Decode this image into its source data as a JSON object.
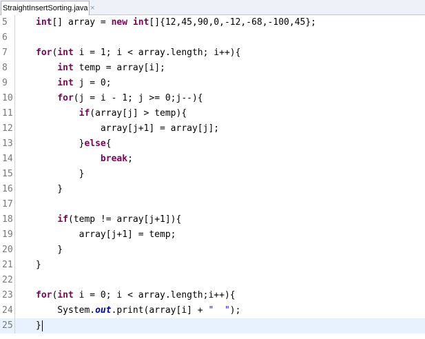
{
  "tab": {
    "title": "StraightInsertSorting.java",
    "close_glyph": "×"
  },
  "editor": {
    "lines": [
      {
        "num": "5",
        "code": "        int[] array = new int[]{12,45,90,0,-12,-68,-100,45};"
      },
      {
        "num": "6",
        "code": ""
      },
      {
        "num": "7",
        "code": "        for(int i = 1; i < array.length; i++){"
      },
      {
        "num": "8",
        "code": "            int temp = array[i];"
      },
      {
        "num": "9",
        "code": "            int j = 0;"
      },
      {
        "num": "10",
        "code": "            for(j = i - 1; j >= 0;j--){"
      },
      {
        "num": "11",
        "code": "                if(array[j] > temp){"
      },
      {
        "num": "12",
        "code": "                    array[j+1] = array[j];"
      },
      {
        "num": "13",
        "code": "                }else{"
      },
      {
        "num": "14",
        "code": "                    break;"
      },
      {
        "num": "15",
        "code": "                }"
      },
      {
        "num": "16",
        "code": "            }"
      },
      {
        "num": "17",
        "code": ""
      },
      {
        "num": "18",
        "code": "            if(temp != array[j+1]){"
      },
      {
        "num": "19",
        "code": "                array[j+1] = temp;"
      },
      {
        "num": "20",
        "code": "            }"
      },
      {
        "num": "21",
        "code": "        }"
      },
      {
        "num": "22",
        "code": ""
      },
      {
        "num": "23",
        "code": "        for(int i = 0; i < array.length;i++){"
      },
      {
        "num": "24",
        "code": "            System.out.print(array[i] + \"  \");"
      },
      {
        "num": "25",
        "code": "        }"
      }
    ],
    "current_line": "25",
    "colors": {
      "keyword": "#7f0055",
      "field": "#0000c0",
      "string": "#2a00ff",
      "line_number": "#787878",
      "current_line_bg": "#e8f2fe"
    }
  }
}
